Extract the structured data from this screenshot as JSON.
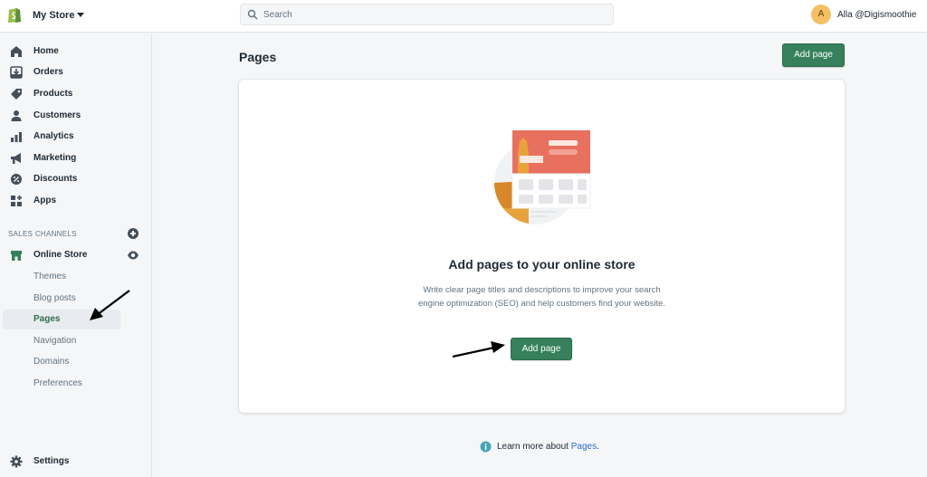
{
  "topbar": {
    "store_name": "My Store",
    "search_placeholder": "Search",
    "avatar_initial": "A",
    "user_name": "Alla @Digismoothie"
  },
  "sidebar": {
    "items": [
      {
        "label": "Home",
        "icon": "home-icon"
      },
      {
        "label": "Orders",
        "icon": "orders-icon"
      },
      {
        "label": "Products",
        "icon": "tag-icon"
      },
      {
        "label": "Customers",
        "icon": "person-icon"
      },
      {
        "label": "Analytics",
        "icon": "bar-chart-icon"
      },
      {
        "label": "Marketing",
        "icon": "megaphone-icon"
      },
      {
        "label": "Discounts",
        "icon": "discount-icon"
      },
      {
        "label": "Apps",
        "icon": "apps-icon"
      }
    ],
    "sales_channels_heading": "SALES CHANNELS",
    "online_store_label": "Online Store",
    "sub_items": [
      "Themes",
      "Blog posts",
      "Pages",
      "Navigation",
      "Domains",
      "Preferences"
    ],
    "active_sub_item": "Pages",
    "settings_label": "Settings"
  },
  "main": {
    "title": "Pages",
    "add_page_label": "Add page",
    "empty_heading": "Add pages to your online store",
    "empty_description": "Write clear page titles and descriptions to improve your search engine optimization (SEO) and help customers find your website.",
    "empty_button_label": "Add page",
    "learn_prefix": "Learn more about ",
    "learn_link": "Pages",
    "learn_suffix": "."
  },
  "colors": {
    "primary_button": "#36805b",
    "active_text": "#2f6f4f",
    "link": "#2c6ecb",
    "avatar": "#f5c065"
  }
}
